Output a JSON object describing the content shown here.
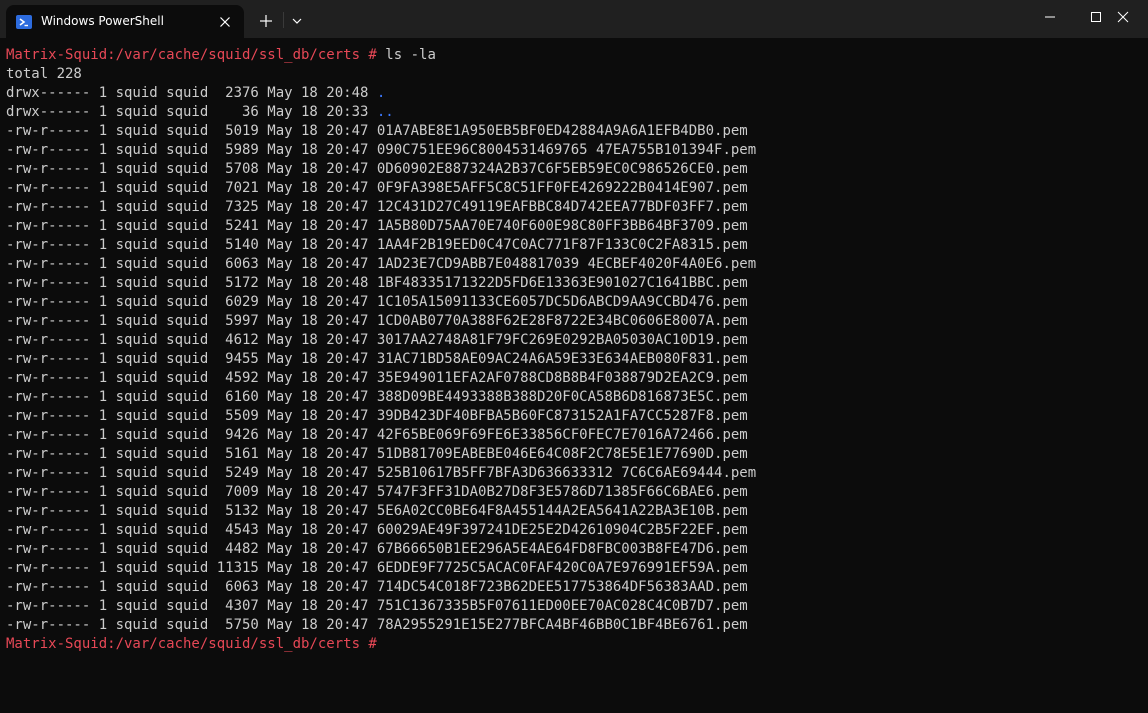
{
  "window": {
    "tab_title": "Windows PowerShell",
    "colors": {
      "background": "#0c0c0c",
      "titlebar": "#202020",
      "prompt": "#e74856",
      "text": "#cccccc",
      "dir": "#3b78ff"
    },
    "icons": [
      "powershell-icon",
      "close-icon",
      "plus-icon",
      "chevron-down-icon",
      "minimize-icon",
      "maximize-icon",
      "window-close-icon"
    ]
  },
  "terminal": {
    "prompt": "Matrix-Squid:/var/cache/squid/ssl_db/certs # ",
    "command": "ls -la",
    "total": "total 228",
    "entries": [
      {
        "meta": "drwx------ 1 squid squid  2376 May 18 20:48 ",
        "name": ".",
        "is_dir": true
      },
      {
        "meta": "drwx------ 1 squid squid    36 May 18 20:33 ",
        "name": "..",
        "is_dir": true
      },
      {
        "meta": "-rw-r----- 1 squid squid  5019 May 18 20:47 ",
        "name": "01A7ABE8E1A950EB5BF0ED42884A9A6A1EFB4DB0.pem",
        "is_dir": false
      },
      {
        "meta": "-rw-r----- 1 squid squid  5989 May 18 20:47 ",
        "name": "090C751EE96C8004531469765 47EA755B101394F.pem",
        "is_dir": false
      },
      {
        "meta": "-rw-r----- 1 squid squid  5708 May 18 20:47 ",
        "name": "0D60902E887324A2B37C6F5EB59EC0C986526CE0.pem",
        "is_dir": false
      },
      {
        "meta": "-rw-r----- 1 squid squid  7021 May 18 20:47 ",
        "name": "0F9FA398E5AFF5C8C51FF0FE4269222B0414E907.pem",
        "is_dir": false
      },
      {
        "meta": "-rw-r----- 1 squid squid  7325 May 18 20:47 ",
        "name": "12C431D27C49119EAFBBC84D742EEA77BDF03FF7.pem",
        "is_dir": false
      },
      {
        "meta": "-rw-r----- 1 squid squid  5241 May 18 20:47 ",
        "name": "1A5B80D75AA70E740F600E98C80FF3BB64BF3709.pem",
        "is_dir": false
      },
      {
        "meta": "-rw-r----- 1 squid squid  5140 May 18 20:47 ",
        "name": "1AA4F2B19EED0C47C0AC771F87F133C0C2FA8315.pem",
        "is_dir": false
      },
      {
        "meta": "-rw-r----- 1 squid squid  6063 May 18 20:47 ",
        "name": "1AD23E7CD9ABB7E048817039 4ECBEF4020F4A0E6.pem",
        "is_dir": false
      },
      {
        "meta": "-rw-r----- 1 squid squid  5172 May 18 20:48 ",
        "name": "1BF48335171322D5FD6E13363E901027C1641BBC.pem",
        "is_dir": false
      },
      {
        "meta": "-rw-r----- 1 squid squid  6029 May 18 20:47 ",
        "name": "1C105A15091133CE6057DC5D6ABCD9AA9CCBD476.pem",
        "is_dir": false
      },
      {
        "meta": "-rw-r----- 1 squid squid  5997 May 18 20:47 ",
        "name": "1CD0AB0770A388F62E28F8722E34BC0606E8007A.pem",
        "is_dir": false
      },
      {
        "meta": "-rw-r----- 1 squid squid  4612 May 18 20:47 ",
        "name": "3017AA2748A81F79FC269E0292BA05030AC10D19.pem",
        "is_dir": false
      },
      {
        "meta": "-rw-r----- 1 squid squid  9455 May 18 20:47 ",
        "name": "31AC71BD58AE09AC24A6A59E33E634AEB080F831.pem",
        "is_dir": false
      },
      {
        "meta": "-rw-r----- 1 squid squid  4592 May 18 20:47 ",
        "name": "35E949011EFA2AF0788CD8B8B4F038879D2EA2C9.pem",
        "is_dir": false
      },
      {
        "meta": "-rw-r----- 1 squid squid  6160 May 18 20:47 ",
        "name": "388D09BE4493388B388D20F0CA58B6D816873E5C.pem",
        "is_dir": false
      },
      {
        "meta": "-rw-r----- 1 squid squid  5509 May 18 20:47 ",
        "name": "39DB423DF40BFBA5B60FC873152A1FA7CC5287F8.pem",
        "is_dir": false
      },
      {
        "meta": "-rw-r----- 1 squid squid  9426 May 18 20:47 ",
        "name": "42F65BE069F69FE6E33856CF0FEC7E7016A72466.pem",
        "is_dir": false
      },
      {
        "meta": "-rw-r----- 1 squid squid  5161 May 18 20:47 ",
        "name": "51DB81709EABEBE046E64C08F2C78E5E1E77690D.pem",
        "is_dir": false
      },
      {
        "meta": "-rw-r----- 1 squid squid  5249 May 18 20:47 ",
        "name": "525B10617B5FF7BFA3D636633312 7C6C6AE69444.pem",
        "is_dir": false
      },
      {
        "meta": "-rw-r----- 1 squid squid  7009 May 18 20:47 ",
        "name": "5747F3FF31DA0B27D8F3E5786D71385F66C6BAE6.pem",
        "is_dir": false
      },
      {
        "meta": "-rw-r----- 1 squid squid  5132 May 18 20:47 ",
        "name": "5E6A02CC0BE64F8A455144A2EA5641A22BA3E10B.pem",
        "is_dir": false
      },
      {
        "meta": "-rw-r----- 1 squid squid  4543 May 18 20:47 ",
        "name": "60029AE49F397241DE25E2D42610904C2B5F22EF.pem",
        "is_dir": false
      },
      {
        "meta": "-rw-r----- 1 squid squid  4482 May 18 20:47 ",
        "name": "67B66650B1EE296A5E4AE64FD8FBC003B8FE47D6.pem",
        "is_dir": false
      },
      {
        "meta": "-rw-r----- 1 squid squid 11315 May 18 20:47 ",
        "name": "6EDDE9F7725C5ACAC0FAF420C0A7E976991EF59A.pem",
        "is_dir": false
      },
      {
        "meta": "-rw-r----- 1 squid squid  6063 May 18 20:47 ",
        "name": "714DC54C018F723B62DEE517753864DF56383AAD.pem",
        "is_dir": false
      },
      {
        "meta": "-rw-r----- 1 squid squid  4307 May 18 20:47 ",
        "name": "751C1367335B5F07611ED00EE70AC028C4C0B7D7.pem",
        "is_dir": false
      },
      {
        "meta": "-rw-r----- 1 squid squid  5750 May 18 20:47 ",
        "name": "78A2955291E15E277BFCA4BF46BB0C1BF4BE6761.pem",
        "is_dir": false
      }
    ],
    "final_prompt": "Matrix-Squid:/var/cache/squid/ssl_db/certs #"
  }
}
